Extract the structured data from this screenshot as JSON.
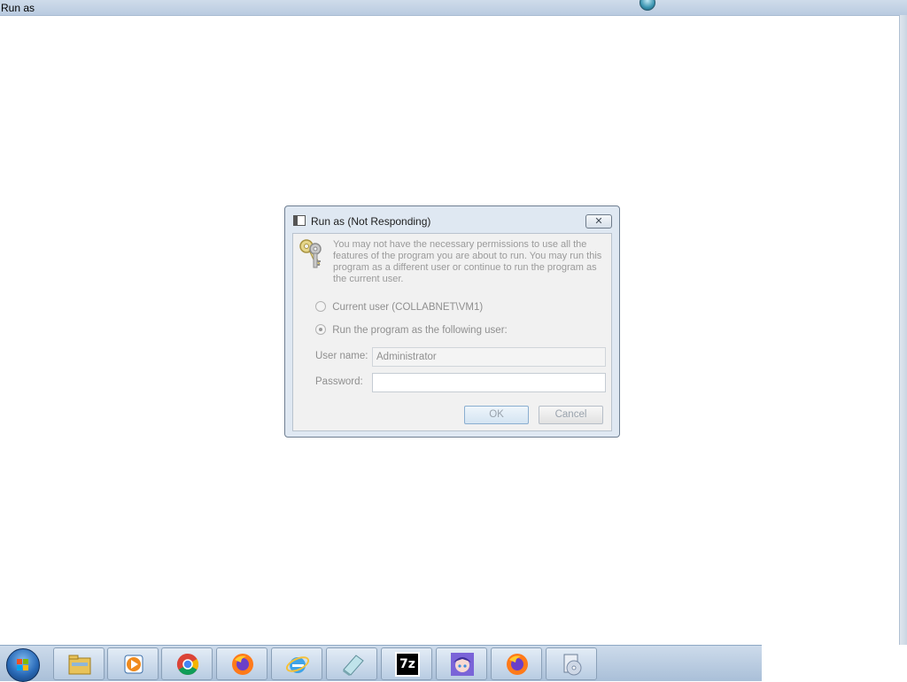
{
  "window": {
    "title": "Run as"
  },
  "dialog": {
    "title": "Run as (Not Responding)",
    "close_glyph": "✕",
    "message": "You may not have the necessary permissions to use all the features of the program you are about to run. You may run this program as a different user or continue to run the program as the current user.",
    "options": {
      "current_user_label": "Current user (COLLABNET\\VM1)",
      "run_as_label": "Run the program as the following user:",
      "selected": "run_as"
    },
    "username_label": "User name:",
    "username_value": "Administrator",
    "password_label": "Password:",
    "password_value": "",
    "ok_label": "OK",
    "cancel_label": "Cancel"
  },
  "taskbar": {
    "start": "start-orb",
    "items": [
      {
        "icon": "windows-explorer-icon"
      },
      {
        "icon": "media-player-icon"
      },
      {
        "icon": "chrome-icon"
      },
      {
        "icon": "firefox-icon"
      },
      {
        "icon": "internet-explorer-icon"
      },
      {
        "icon": "notepad-icon"
      },
      {
        "icon": "7zip-icon",
        "text": "7z"
      },
      {
        "icon": "anime-avatar-icon"
      },
      {
        "icon": "firefox-icon"
      },
      {
        "icon": "disc-installer-icon"
      }
    ]
  }
}
